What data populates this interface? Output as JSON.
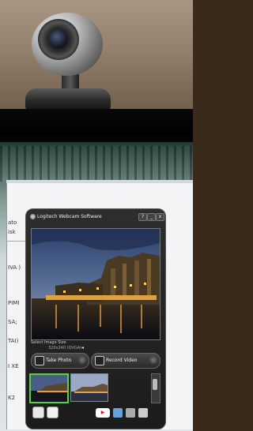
{
  "window": {
    "title": "Logitech Webcam Software",
    "buttons": {
      "help": "?",
      "minimize": "_",
      "close": "x"
    }
  },
  "preview": {
    "label": "Select Image Size",
    "resolution": "320x240 (QVGA)"
  },
  "actions": {
    "take_photo": "Take Photo",
    "record_video": "Record Video"
  },
  "background_window": {
    "fragments": [
      "ato",
      "isk",
      "IVA )",
      "PIMI",
      "SA;",
      "TAI)",
      "I XE",
      "K2"
    ]
  },
  "icons": [
    "webcam-icon",
    "logitech-logo-icon",
    "camera-icon",
    "video-camera-icon",
    "capture-button-icon",
    "person-icon",
    "film-strip-icon",
    "youtube-icon",
    "share-icon",
    "folder-icon",
    "trash-icon"
  ],
  "colors": {
    "window_bg": "#1b1b1b",
    "selected_thumb": "#55d14d",
    "youtube": "#d11111"
  }
}
